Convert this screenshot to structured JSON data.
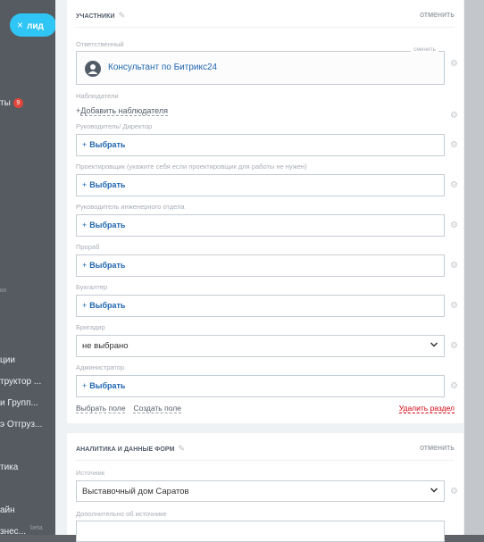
{
  "background": {
    "lead_button": {
      "close": "×",
      "label": "лид"
    },
    "left_items": [
      {
        "text": "ты",
        "badge": "9"
      },
      {
        "text": "ции"
      },
      {
        "text": "труктор ..."
      },
      {
        "text": "и Групп..."
      },
      {
        "text": "э Отгруз..."
      },
      {
        "text": "тика"
      },
      {
        "text": "айн"
      },
      {
        "text": "знес..."
      }
    ],
    "muted_items": [
      "ки",
      "beta"
    ]
  },
  "participants": {
    "title": "УЧАСТНИКИ",
    "cancel": "отменить",
    "responsible_label": "Ответственный",
    "change_label": "сменить",
    "responsible_name": "Консультант по Битрикс24",
    "observers_label": "Наблюдатели",
    "add_observer": "Добавить наблюдателя",
    "add_observer_prefix": "+",
    "pick_prefix": "+",
    "pick_text": "Выбрать",
    "fields": [
      {
        "label": "Руководитель/ Директор"
      },
      {
        "label": "Проектировщик (укажите себя если проектировщик для работы не нужен)"
      },
      {
        "label": "Руководитель инженерного отдела"
      },
      {
        "label": "Прораб"
      },
      {
        "label": "Бухгалтер"
      }
    ],
    "brigadier_label": "Бригадир",
    "brigadier_value": "не выбрано",
    "admin_label": "Администратор",
    "select_field": "Выбрать поле",
    "create_field": "Создать поле",
    "delete_section": "Удалить раздел"
  },
  "analytics": {
    "title": "АНАЛИТИКА И ДАННЫЕ ФОРМ",
    "cancel": "отменить",
    "source_label": "Источник",
    "source_value": "Выставочный дом Саратов",
    "extra_label": "Дополнительно об источнике"
  },
  "colors": {
    "accent": "#2fc6f6",
    "link": "#2067b0",
    "danger": "#d2000d",
    "badge": "#e0463a"
  }
}
